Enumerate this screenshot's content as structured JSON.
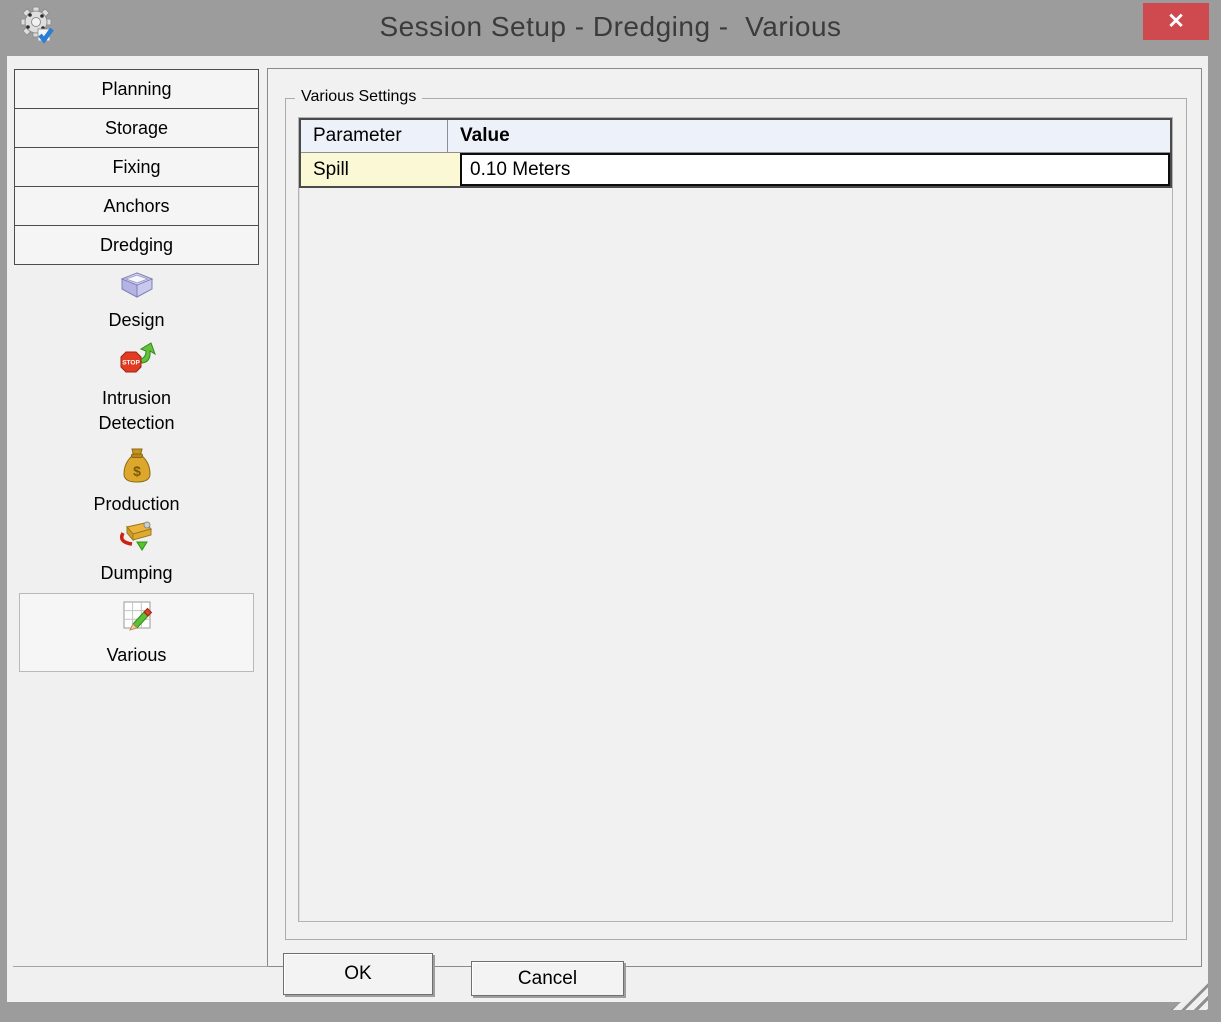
{
  "window": {
    "title": "Session Setup - Dredging -  Various",
    "close_glyph": "✕"
  },
  "sidebar": {
    "buttons": [
      {
        "label": "Planning"
      },
      {
        "label": "Storage"
      },
      {
        "label": "Fixing"
      },
      {
        "label": "Anchors"
      },
      {
        "label": "Dredging"
      }
    ],
    "tools": [
      {
        "label": "Design",
        "icon": "design-box-icon",
        "selected": false
      },
      {
        "label": "Intrusion Detection",
        "icon": "intrusion-detection-icon",
        "selected": false
      },
      {
        "label": "Production",
        "icon": "production-moneybag-icon",
        "selected": false
      },
      {
        "label": "Dumping",
        "icon": "dumping-icon",
        "selected": false
      },
      {
        "label": "Various",
        "icon": "various-grid-pencil-icon",
        "selected": true
      }
    ]
  },
  "main": {
    "group_title": "Various Settings",
    "table": {
      "columns": [
        "Parameter",
        "Value"
      ],
      "rows": [
        {
          "parameter": "Spill",
          "value": "0.10 Meters"
        }
      ]
    }
  },
  "buttons": {
    "ok": "OK",
    "cancel": "Cancel"
  },
  "colors": {
    "titlebar": "#9c9c9c",
    "title_text": "#3b3b3b",
    "close_button": "#cf4a4e",
    "client_bg": "#f0f0f0",
    "table_header_bg": "#edf1f9",
    "parameter_cell_bg": "#fbf8d5",
    "selected_tool_border": "#b9b9b9"
  }
}
